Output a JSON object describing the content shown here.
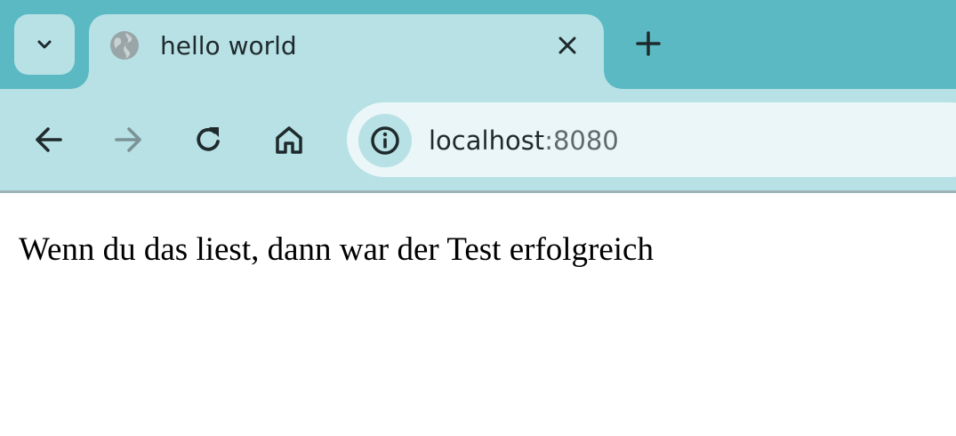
{
  "browser": {
    "tab": {
      "title": "hello world",
      "favicon": "globe-icon"
    },
    "tab_search_icon": "chevron-down-icon",
    "tab_close_icon": "close-icon",
    "new_tab_icon": "plus-icon",
    "toolbar": {
      "back_icon": "arrow-left-icon",
      "forward_icon": "arrow-right-icon",
      "reload_icon": "reload-icon",
      "home_icon": "home-icon",
      "site_info_icon": "info-icon"
    },
    "address_bar": {
      "host": "localhost",
      "port": ":8080"
    },
    "colors": {
      "tabstrip_bg": "#5bb9c3",
      "active_tab_bg": "#b7e1e5",
      "omnibox_bg": "#eaf6f7",
      "icon_color": "#1f2a2c",
      "disabled_icon_color": "#7b9296"
    }
  },
  "page": {
    "text": "Wenn du das liest, dann war der Test erfolgreich"
  }
}
